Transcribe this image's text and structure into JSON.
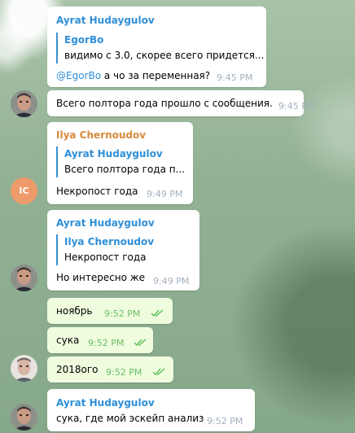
{
  "messages": {
    "m1": {
      "sender": "Ayrat Hudaygulov",
      "reply_name": "EgorBo",
      "reply_text": "видимо с 3.0, скорее всего придется...",
      "mention": "@EgorBo",
      "text": " а чо за переменная?",
      "time": "9:45 PM"
    },
    "m2": {
      "text": "Всего полтора года прошло с сообщения.",
      "time": "9:45 PM"
    },
    "m3": {
      "sender": "Ilya Chernoudov",
      "reply_name": "Ayrat Hudaygulov",
      "reply_text": "Всего полтора года п...",
      "text": "Некропост года",
      "time": "9:49 PM",
      "avatar_initials": "IC"
    },
    "m4": {
      "sender": "Ayrat Hudaygulov",
      "reply_name": "Ilya Chernoudov",
      "reply_text": "Некропост года",
      "text": "Но интересно же",
      "time": "9:49 PM"
    },
    "m5": {
      "text": "ноябрь",
      "time": "9:52 PM"
    },
    "m6": {
      "text": "сука",
      "time": "9:52 PM"
    },
    "m7": {
      "text": "2018ого",
      "time": "9:52 PM"
    },
    "m8": {
      "sender": "Ayrat Hudaygulov",
      "text": "сука, где мой эскейп анализ",
      "time": "9:52 PM"
    }
  },
  "colors": {
    "name_blue": "#2f8fd8",
    "name_orange": "#d88a3a",
    "outgoing_bubble": "#effdde",
    "read_checks": "#5bbd5a"
  }
}
